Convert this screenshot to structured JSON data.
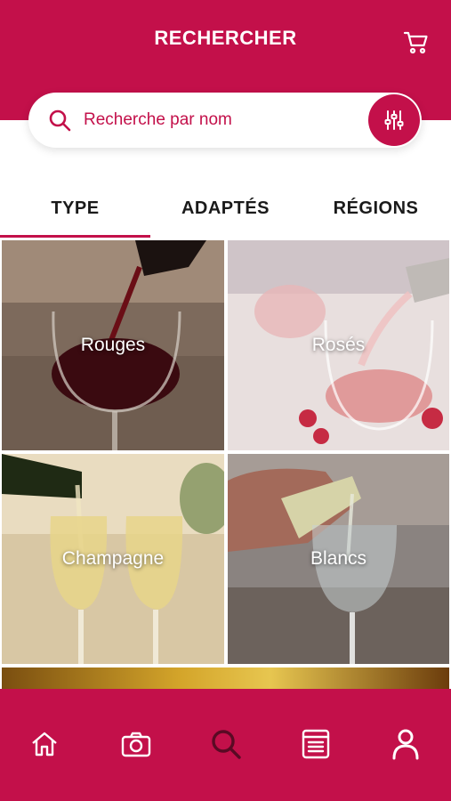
{
  "header": {
    "title": "RECHERCHER",
    "cart_icon": "cart-icon"
  },
  "search": {
    "placeholder": "Recherche par nom",
    "search_icon": "search-icon",
    "filter_icon": "sliders-icon"
  },
  "tabs": [
    {
      "label": "TYPE",
      "active": true
    },
    {
      "label": "ADAPTÉS",
      "active": false
    },
    {
      "label": "RÉGIONS",
      "active": false
    }
  ],
  "categories": [
    {
      "label": "Rouges"
    },
    {
      "label": "Rosés"
    },
    {
      "label": "Champagne"
    },
    {
      "label": "Blancs"
    }
  ],
  "bottom_nav": [
    {
      "icon": "home-icon",
      "active": false
    },
    {
      "icon": "camera-icon",
      "active": false
    },
    {
      "icon": "search-icon",
      "active": true
    },
    {
      "icon": "list-icon",
      "active": false
    },
    {
      "icon": "user-icon",
      "active": false
    }
  ],
  "colors": {
    "primary": "#c3104a",
    "active_nav": "#5a0a24",
    "white": "#ffffff"
  }
}
